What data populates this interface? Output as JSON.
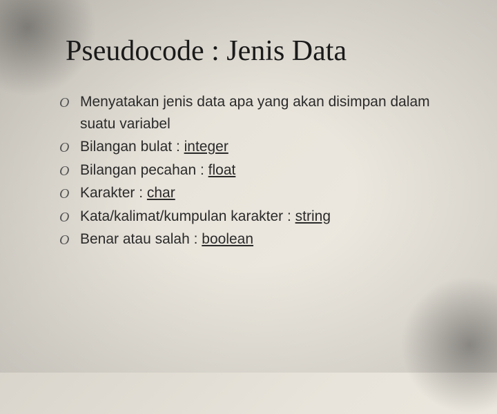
{
  "title": "Pseudocode : Jenis Data",
  "items": [
    {
      "text": "Menyatakan jenis data apa yang akan disimpan dalam suatu variabel",
      "keyword": ""
    },
    {
      "text": "Bilangan bulat : ",
      "keyword": "integer"
    },
    {
      "text": "Bilangan pecahan : ",
      "keyword": "float"
    },
    {
      "text": "Karakter : ",
      "keyword": "char"
    },
    {
      "text": "Kata/kalimat/kumpulan karakter : ",
      "keyword": "string"
    },
    {
      "text": "Benar atau salah : ",
      "keyword": "boolean"
    }
  ],
  "bullet_glyph": "O"
}
